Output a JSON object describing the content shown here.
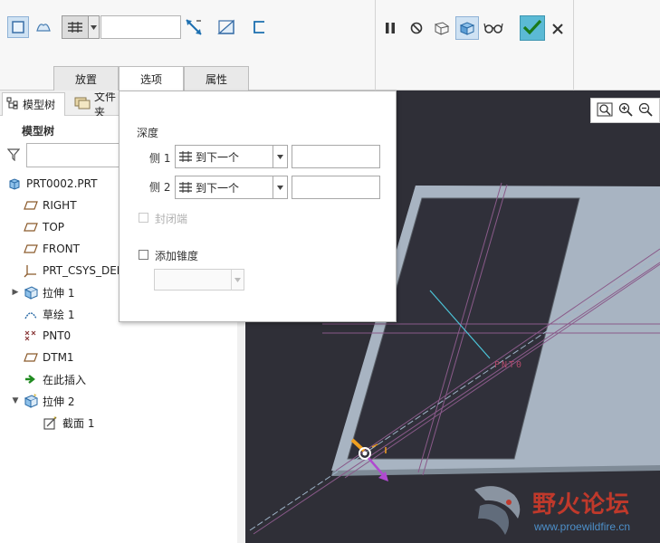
{
  "ribbon": {
    "tabs": [
      "放置",
      "选项",
      "属性"
    ],
    "active_tab": "选项",
    "depth_value": "",
    "icons": {
      "solid": "solid-icon",
      "surface": "surface-icon",
      "depth_type": "blind-depth-icon",
      "flip": "flip-direction-icon",
      "remove_material": "remove-material-icon",
      "thicken": "thicken-sketch-icon",
      "pause": "pause-icon",
      "no_preview": "no-preview-icon",
      "geometry_preview": "geometry-preview-icon",
      "verify": "verify-icon",
      "glasses": "glasses-icon",
      "ok": "checkmark-icon",
      "cancel": "close-icon"
    },
    "ok_color": "#5bbad5"
  },
  "left_panel": {
    "tabs": [
      "模型树",
      "文件夹"
    ],
    "title": "模型树",
    "filter_placeholder": "",
    "tree": [
      {
        "label": "PRT0002.PRT",
        "icon": "part-icon"
      },
      {
        "label": "RIGHT",
        "icon": "datum-plane-icon"
      },
      {
        "label": "TOP",
        "icon": "datum-plane-icon"
      },
      {
        "label": "FRONT",
        "icon": "datum-plane-icon"
      },
      {
        "label": "PRT_CSYS_DEF",
        "icon": "coordinate-system-icon"
      },
      {
        "label": "拉伸 1",
        "icon": "extrude-icon"
      },
      {
        "label": "草绘 1",
        "icon": "sketch-icon"
      },
      {
        "label": "PNT0",
        "icon": "datum-point-icon"
      },
      {
        "label": "DTM1",
        "icon": "datum-plane-icon"
      },
      {
        "label": "在此插入",
        "icon": "insert-here-icon"
      },
      {
        "label": "拉伸 2",
        "icon": "extrude-icon"
      },
      {
        "label": "截面 1",
        "icon": "section-icon"
      }
    ]
  },
  "options_popup": {
    "depth_title": "深度",
    "side1_label": "侧 1",
    "side2_label": "侧 2",
    "side1_value": "到下一个",
    "side2_value": "到下一个",
    "side1_input": "",
    "side2_input": "",
    "capped_ends_label": "封闭端",
    "add_taper_label": "添加锥度",
    "taper_value": ""
  },
  "graphics": {
    "point_label": "PNT0",
    "background_color": "#2f2f37",
    "plate_color": "#a8b4c2",
    "cutout_color": "#30303a"
  },
  "watermark": {
    "text": "野火论坛",
    "url": "www.proewildfire.cn"
  }
}
